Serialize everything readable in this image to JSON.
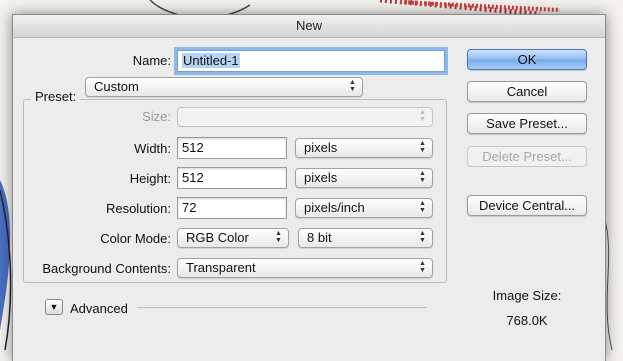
{
  "dialog": {
    "title": "New"
  },
  "form": {
    "name_label": "Name:",
    "name_value": "Untitled-1",
    "preset_label": "Preset:",
    "preset_value": "Custom",
    "size_label": "Size:",
    "size_value": "",
    "width_label": "Width:",
    "width_value": "512",
    "width_unit": "pixels",
    "height_label": "Height:",
    "height_value": "512",
    "height_unit": "pixels",
    "resolution_label": "Resolution:",
    "resolution_value": "72",
    "resolution_unit": "pixels/inch",
    "color_mode_label": "Color Mode:",
    "color_mode_value": "RGB Color",
    "bit_depth_value": "8 bit",
    "background_label": "Background Contents:",
    "background_value": "Transparent",
    "advanced_label": "Advanced"
  },
  "buttons": {
    "ok": "OK",
    "cancel": "Cancel",
    "save_preset": "Save Preset...",
    "delete_preset": "Delete Preset...",
    "device_central": "Device Central..."
  },
  "image_size": {
    "label": "Image Size:",
    "value": "768.0K"
  },
  "icons": {
    "popup_arrows": "up-down-arrows-icon",
    "disclosure": "disclosure-triangle-icon"
  },
  "colors": {
    "default_button": "#8ebbf0",
    "focus_ring": "#8db9e6",
    "dialog_bg": "#ececec"
  }
}
